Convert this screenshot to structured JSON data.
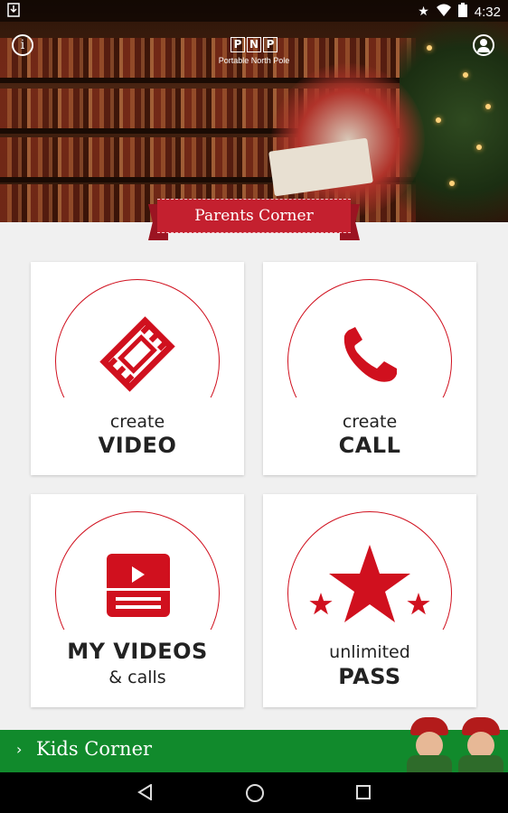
{
  "status_bar": {
    "time": "4:32",
    "icons": [
      "download-icon",
      "star-icon",
      "wifi-icon",
      "battery-icon"
    ]
  },
  "header": {
    "logo_letters": [
      "P",
      "N",
      "P"
    ],
    "logo_subtitle": "Portable North Pole",
    "icons": [
      "info-icon",
      "profile-icon"
    ]
  },
  "banner": {
    "label": "Parents Corner"
  },
  "accent_color": "#d0101e",
  "cards": [
    {
      "line1": "create",
      "line2": "VIDEO",
      "icon": "film-icon"
    },
    {
      "line1": "create",
      "line2": "CALL",
      "icon": "phone-icon"
    },
    {
      "line1": "MY VIDEOS",
      "line2": "& calls",
      "icon": "video-library-icon"
    },
    {
      "line1": "unlimited",
      "line2": "PASS",
      "icon": "star-icon"
    }
  ],
  "kids_corner": {
    "label": "Kids Corner",
    "color": "#118a2c"
  },
  "nav": {
    "icons": [
      "back-icon",
      "home-icon",
      "recents-icon"
    ]
  }
}
